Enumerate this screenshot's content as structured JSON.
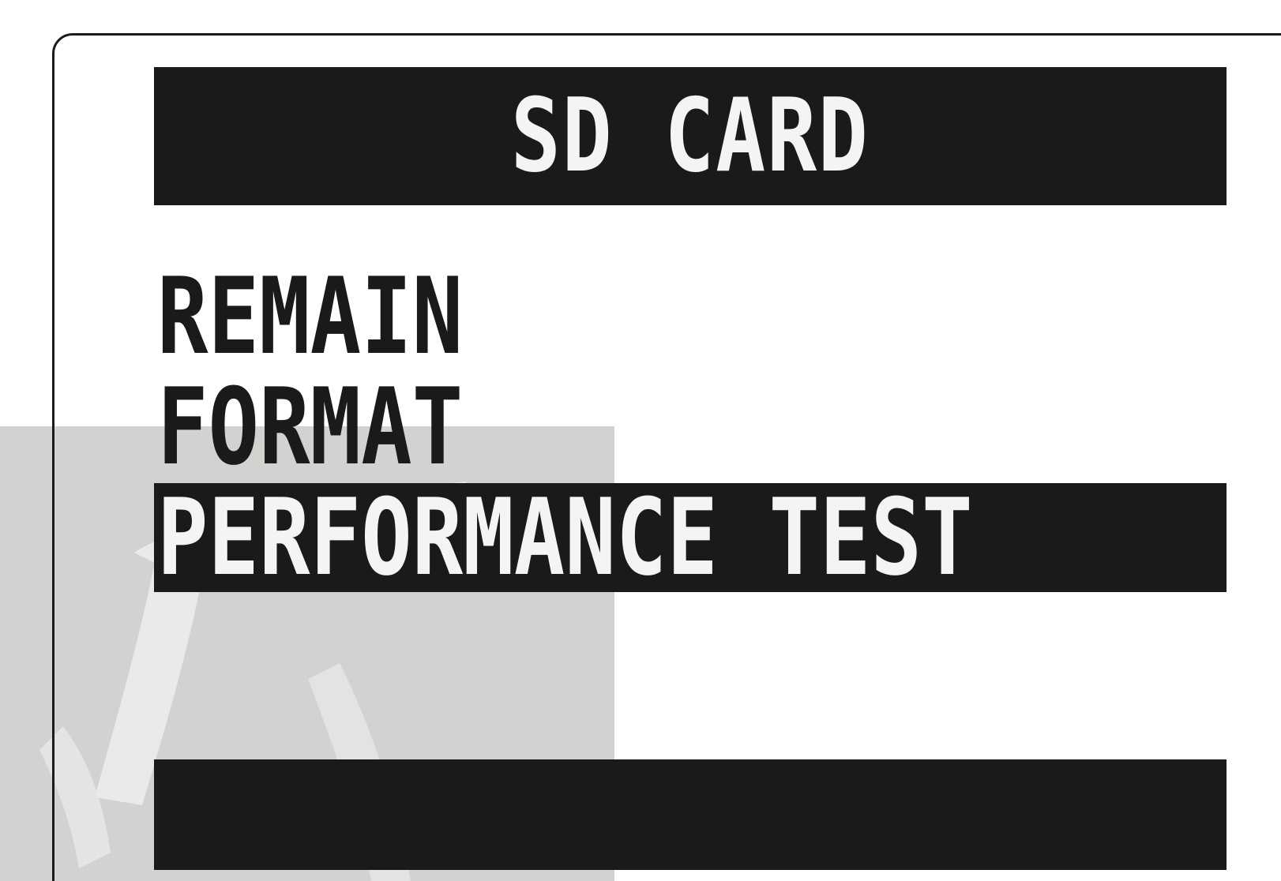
{
  "screen": {
    "title": "SD CARD"
  },
  "menu": {
    "items": [
      {
        "label": "REMAIN",
        "selected": false
      },
      {
        "label": "FORMAT",
        "selected": false
      },
      {
        "label": "PERFORMANCE TEST",
        "selected": true
      }
    ]
  },
  "colors": {
    "lcd_dark": "#1b1a1a",
    "lcd_light": "#f4f4f4",
    "background_shadow": "#d2d2d0"
  }
}
